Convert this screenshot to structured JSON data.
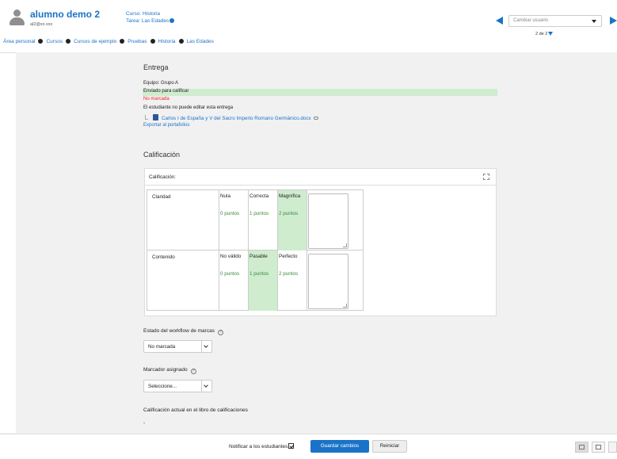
{
  "header": {
    "user_name": "alumno demo 2",
    "user_email": "al2@xx.xxx",
    "course_label": "Curso: Historia",
    "task_label": "Tarea: Las Edades",
    "switch_user_placeholder": "Cambiar usuario",
    "counter": "2 de 2"
  },
  "breadcrumb": [
    "Área personal",
    "Cursos",
    "Cursos de ejemplo",
    "Pruebas",
    "Historia",
    "Las Edades"
  ],
  "submission": {
    "title": "Entrega",
    "team": "Equipo: Grupo A",
    "status": "Enviado para calificar",
    "grading_status": "No marcada",
    "edit_status": "El estudiante no puede editar esta entrega",
    "file_name": "Carlos I de España y V del Sacro Imperio Romano Germánico.docx",
    "export_link": "Exportar al portafolios"
  },
  "grading": {
    "title": "Calificación",
    "box_label": "Calificación:",
    "rubric": [
      {
        "criterion": "Claridad",
        "levels": [
          {
            "label": "Nula",
            "points": "0 puntos",
            "selected": false
          },
          {
            "label": "Correcta",
            "points": "1 puntos",
            "selected": false
          },
          {
            "label": "Magnífica",
            "points": "2 puntos",
            "selected": true
          }
        ]
      },
      {
        "criterion": "Contenido",
        "levels": [
          {
            "label": "No válido",
            "points": "0 puntos",
            "selected": false
          },
          {
            "label": "Pasable",
            "points": "1 puntos",
            "selected": true
          },
          {
            "label": "Perfecto",
            "points": "2 puntos",
            "selected": false
          }
        ]
      }
    ]
  },
  "workflow": {
    "label": "Estado del workflow de marcas",
    "value": "No marcada"
  },
  "marker": {
    "label": "Marcador asignado",
    "value": "Seleccione..."
  },
  "gradebook": {
    "label": "Calificación actual en el libro de calificaciones",
    "value": "-"
  },
  "footer": {
    "notify_label": "Notificar a los estudiantes",
    "save_label": "Guardar cambios",
    "reset_label": "Reiniciar"
  },
  "colors": {
    "accent": "#1a73c8",
    "selected": "#cfeccf",
    "alert": "#ee2222"
  }
}
